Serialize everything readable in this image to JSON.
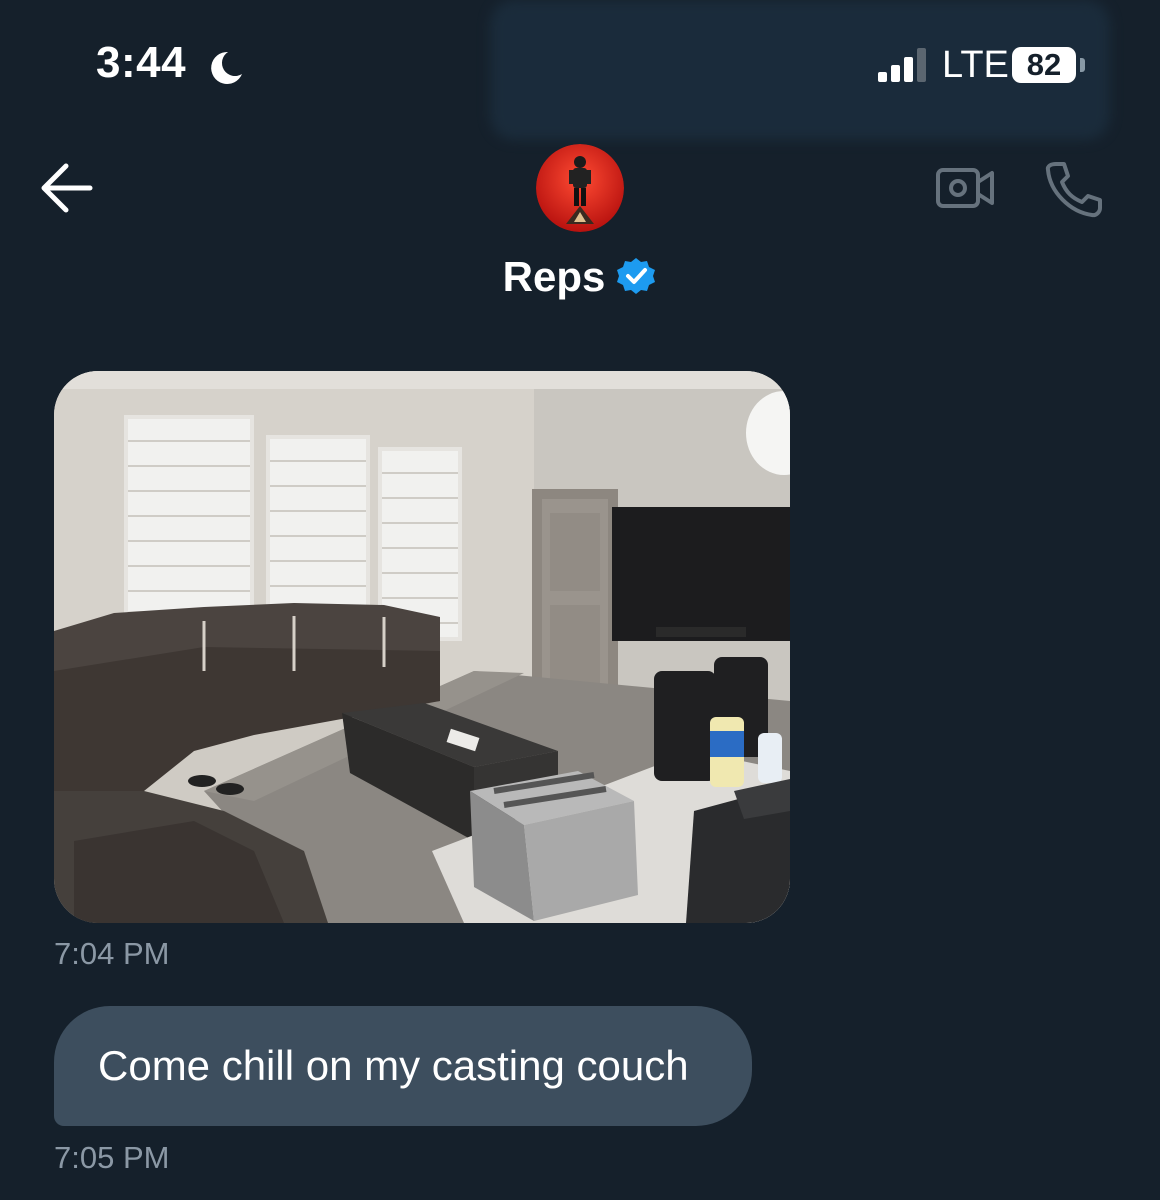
{
  "status_bar": {
    "time": "3:44",
    "network": "LTE",
    "battery": "82",
    "icons": [
      "moon-icon",
      "signal-icon"
    ]
  },
  "header": {
    "contact_name": "Reps",
    "verified": true,
    "icons": [
      "back-arrow-icon",
      "verified-badge-icon",
      "video-camera-icon",
      "phone-icon"
    ],
    "colors": {
      "verified": "#1d9bf0",
      "avatar_bg": "#e0241f"
    }
  },
  "messages": [
    {
      "type": "photo",
      "subject": "living-room-photo",
      "timestamp": "7:04 PM"
    },
    {
      "type": "text",
      "text": "Come chill on my casting couch",
      "timestamp": "7:05 PM"
    }
  ],
  "colors": {
    "background": "#15202b",
    "bubble": "#3d4e5e",
    "timestamp": "#8b98a5"
  }
}
